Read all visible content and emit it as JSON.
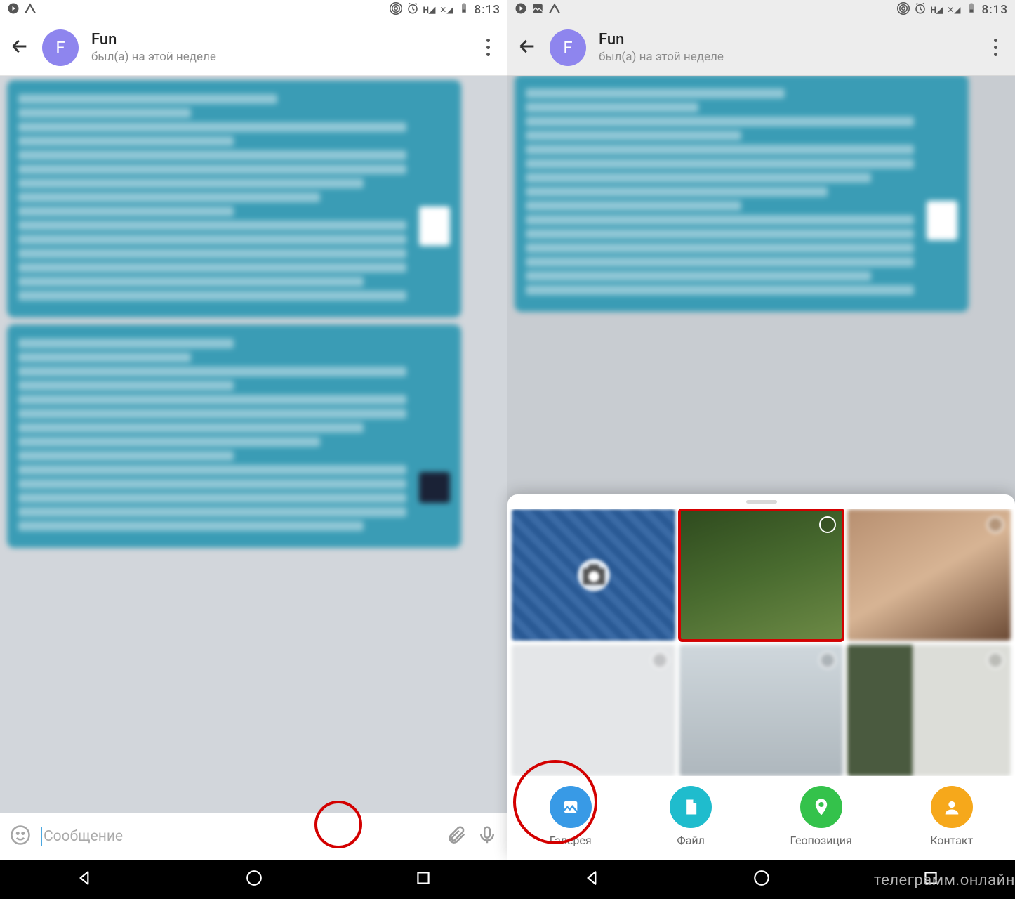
{
  "status": {
    "time": "8:13"
  },
  "chat": {
    "name": "Fun",
    "status": "был(а) на этой неделе",
    "avatar_letter": "F"
  },
  "input": {
    "placeholder": "Сообщение"
  },
  "sheet": {
    "actions": [
      {
        "id": "gallery",
        "label": "Галерея"
      },
      {
        "id": "file",
        "label": "Файл"
      },
      {
        "id": "location",
        "label": "Геопозиция"
      },
      {
        "id": "contact",
        "label": "Контакт"
      }
    ]
  },
  "watermark": "телеграмм.онлайн"
}
